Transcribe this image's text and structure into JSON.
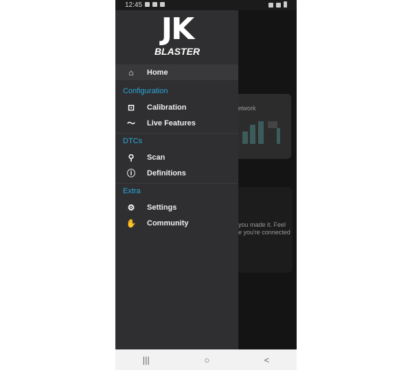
{
  "status": {
    "time": "12:45"
  },
  "logo": {
    "text_main": "JK",
    "text_sub": "BLASTER"
  },
  "menu": {
    "home": "Home",
    "sections": [
      {
        "title": "Configuration",
        "items": [
          {
            "label": "Calibration",
            "icon": "chip-icon"
          },
          {
            "label": "Live Features",
            "icon": "trending-icon"
          }
        ]
      },
      {
        "title": "DTCs",
        "items": [
          {
            "label": "Scan",
            "icon": "search-icon"
          },
          {
            "label": "Definitions",
            "icon": "info-icon"
          }
        ]
      },
      {
        "title": "Extra",
        "items": [
          {
            "label": "Settings",
            "icon": "gear-icon"
          },
          {
            "label": "Community",
            "icon": "hand-icon"
          }
        ]
      }
    ]
  },
  "background": {
    "card1_title": "etwork",
    "card2_line1": "you made it. Feel",
    "card2_line2": "e you're connected"
  },
  "navbar": {
    "recents": "|||",
    "home": "○",
    "back": "<"
  }
}
